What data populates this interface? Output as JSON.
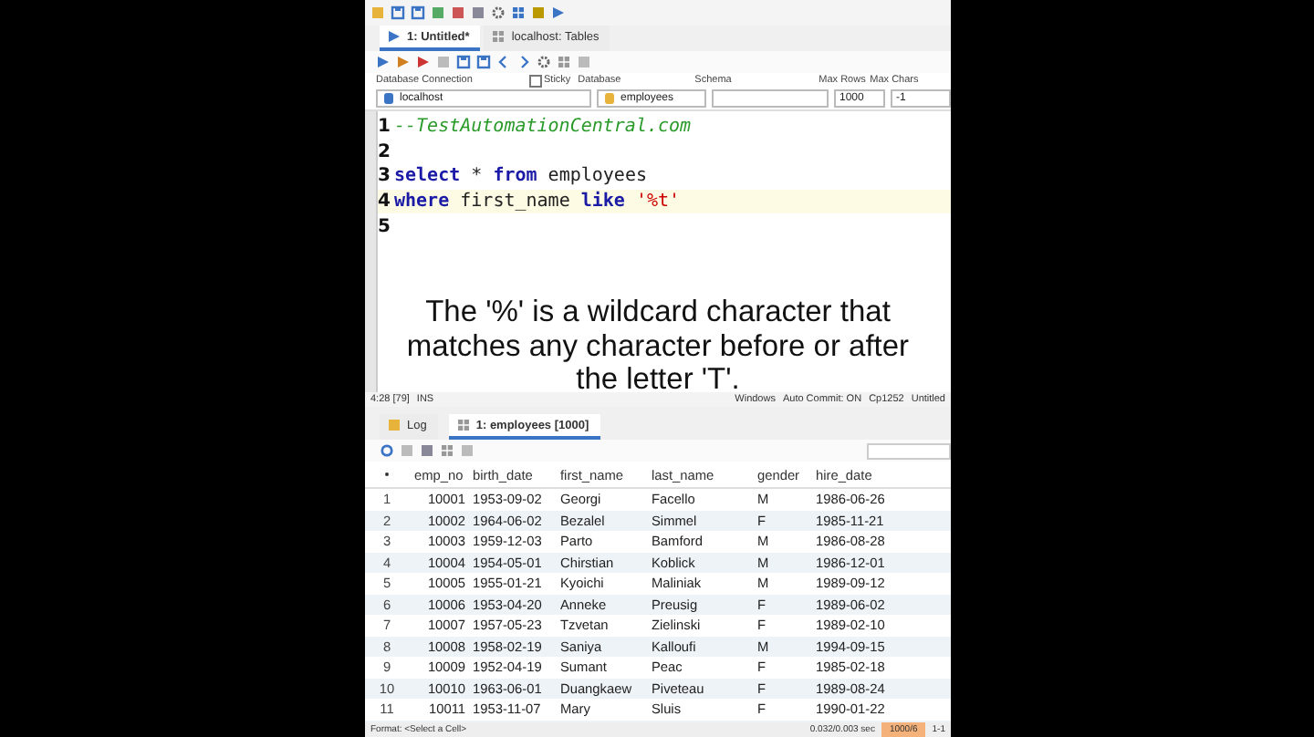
{
  "editor_tabs": [
    {
      "label": "1: Untitled*",
      "selected": true
    },
    {
      "label": "localhost: Tables",
      "selected": false
    }
  ],
  "connection_bar": {
    "database_connection_label": "Database Connection",
    "sticky": {
      "label": "Sticky",
      "checked": false
    },
    "database_label": "Database",
    "schema_label": "Schema",
    "max_rows_label": "Max Rows",
    "max_chars_label": "Max Chars",
    "connection": "localhost",
    "database": "employees",
    "max_rows": "1000",
    "max_chars": "-1"
  },
  "editor": {
    "lines": [
      {
        "number": "1",
        "tokens": [
          {
            "kind": "comment",
            "text": "--TestAutomationCentral.com"
          }
        ]
      },
      {
        "number": "2"
      },
      {
        "number": "3",
        "tokens": [
          {
            "kind": "keyword",
            "text": "select"
          },
          {
            "kind": "plain",
            "text": " * "
          },
          {
            "kind": "keyword",
            "text": "from"
          },
          {
            "kind": "plain",
            "text": " employees"
          }
        ]
      },
      {
        "number": "4",
        "current": true,
        "tokens": [
          {
            "kind": "keyword",
            "text": "where"
          },
          {
            "kind": "plain",
            "text": " first_name "
          },
          {
            "kind": "keyword",
            "text": "like"
          },
          {
            "kind": "string",
            "text": " '%t'"
          }
        ]
      },
      {
        "number": "5"
      }
    ]
  },
  "caption": "The '%' is a wildcard character that matches any character before or after the letter 'T'.",
  "status_bar": {
    "position": "4:28 [79]",
    "mode": "INS",
    "line_ending": "Windows",
    "auto_commit": "Auto Commit: ON",
    "encoding": "Cp1252",
    "file": "Untitled"
  },
  "result_tabs": [
    {
      "label": "Log",
      "selected": false
    },
    {
      "label": "1: employees [1000]",
      "selected": true
    }
  ],
  "table": {
    "columns": [
      "emp_no",
      "birth_date",
      "first_name",
      "last_name",
      "gender",
      "hire_date"
    ],
    "rows": [
      {
        "number": "1",
        "cells": [
          "10001",
          "1953-09-02",
          "Georgi",
          "Facello",
          "M",
          "1986-06-26"
        ]
      },
      {
        "number": "2",
        "cells": [
          "10002",
          "1964-06-02",
          "Bezalel",
          "Simmel",
          "F",
          "1985-11-21"
        ]
      },
      {
        "number": "3",
        "cells": [
          "10003",
          "1959-12-03",
          "Parto",
          "Bamford",
          "M",
          "1986-08-28"
        ]
      },
      {
        "number": "4",
        "cells": [
          "10004",
          "1954-05-01",
          "Chirstian",
          "Koblick",
          "M",
          "1986-12-01"
        ]
      },
      {
        "number": "5",
        "cells": [
          "10005",
          "1955-01-21",
          "Kyoichi",
          "Maliniak",
          "M",
          "1989-09-12"
        ]
      },
      {
        "number": "6",
        "cells": [
          "10006",
          "1953-04-20",
          "Anneke",
          "Preusig",
          "F",
          "1989-06-02"
        ]
      },
      {
        "number": "7",
        "cells": [
          "10007",
          "1957-05-23",
          "Tzvetan",
          "Zielinski",
          "F",
          "1989-02-10"
        ]
      },
      {
        "number": "8",
        "cells": [
          "10008",
          "1958-02-19",
          "Saniya",
          "Kalloufi",
          "M",
          "1994-09-15"
        ]
      },
      {
        "number": "9",
        "cells": [
          "10009",
          "1952-04-19",
          "Sumant",
          "Peac",
          "F",
          "1985-02-18"
        ]
      },
      {
        "number": "10",
        "cells": [
          "10010",
          "1963-06-01",
          "Duangkaew",
          "Piveteau",
          "F",
          "1989-08-24"
        ]
      },
      {
        "number": "11",
        "cells": [
          "10011",
          "1953-11-07",
          "Mary",
          "Sluis",
          "F",
          "1990-01-22"
        ]
      }
    ]
  },
  "results_status": {
    "format": "Format: <Select a Cell>",
    "timing": "0.032/0.003 sec",
    "row_count": "1000/6",
    "range": "1-1"
  }
}
